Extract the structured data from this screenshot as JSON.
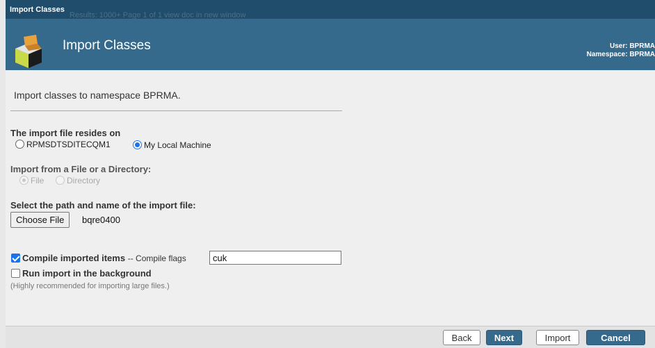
{
  "window": {
    "title": "Import Classes",
    "ghost_toolbar": "Results: 1000+   Page   1   of 1   view doc in new window"
  },
  "header": {
    "title": "Import Classes",
    "user_label": "User: BPRMA",
    "namespace_label": "Namespace: BPRMA"
  },
  "intro": "Import classes to namespace BPRMA.",
  "file_location": {
    "label": "The import file resides on",
    "options": [
      "RPMSDTSDITECQM1",
      "My Local Machine"
    ],
    "selected": "My Local Machine"
  },
  "import_from": {
    "label": "Import from a File or a Directory:",
    "options": [
      "File",
      "Directory"
    ],
    "selected": "File",
    "disabled": true
  },
  "path_select": {
    "label": "Select the path and name of the import file:",
    "button_label": "Choose File",
    "file_name": "bqre0400"
  },
  "compile": {
    "label": "Compile imported items",
    "checked": true,
    "flags_label": "-- Compile flags",
    "flags_value": "cuk"
  },
  "background": {
    "label": "Run import in the background",
    "checked": false,
    "note": "(Highly recommended for importing large files.)"
  },
  "buttons": {
    "back": "Back",
    "next": "Next",
    "import": "Import",
    "cancel": "Cancel"
  },
  "colors": {
    "header": "#356a8c",
    "titlebar": "#1f4d6b",
    "accent": "#1a73e8"
  }
}
